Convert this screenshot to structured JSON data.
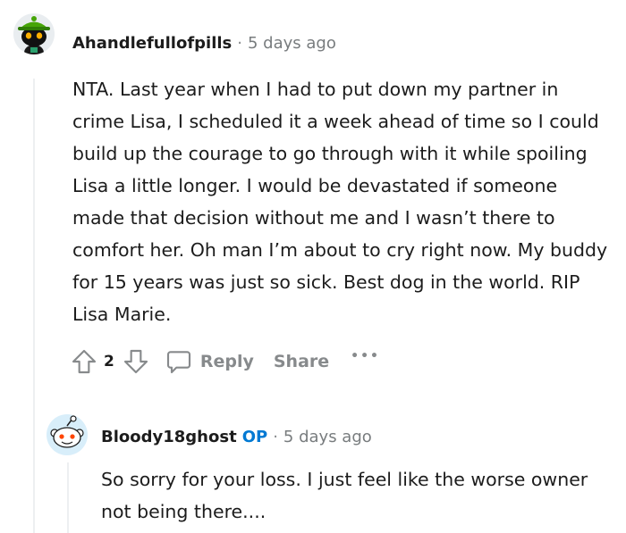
{
  "comments": [
    {
      "author": "Ahandlefullofpills",
      "time": "5 days ago",
      "body": "NTA. Last year when I had to put down my partner in crime Lisa, I scheduled it a week ahead of time so I could build up the courage to go through with it while spoiling Lisa a little longer. I would be devastated if someone made that decision without me and I wasn’t there to comfort her. Oh man I’m about to cry right now. My buddy for 15 years was just so sick. Best dog in the world. RIP Lisa Marie.",
      "votes": "2",
      "reply_label": "Reply",
      "share_label": "Share",
      "more_label": "•••"
    },
    {
      "author": "Bloody18ghost",
      "op_badge": "OP",
      "time": "5 days ago",
      "body": "So sorry for your loss. I just feel like the worse owner not being there...."
    }
  ],
  "separator": "·",
  "colors": {
    "op": "#0079d3",
    "meta": "#787c7e",
    "thread_line": "#edeff1",
    "avatar1_bg": "#e9edf0",
    "avatar1_hat": "#46a508",
    "avatar2_bg": "#d8eefa"
  },
  "icons": {
    "avatar1": "snoo-avatar-green-hat",
    "avatar2": "snoo-avatar-default",
    "upvote": "upvote-arrow-icon",
    "downvote": "downvote-arrow-icon",
    "reply": "speech-bubble-icon",
    "more": "ellipsis-icon"
  }
}
